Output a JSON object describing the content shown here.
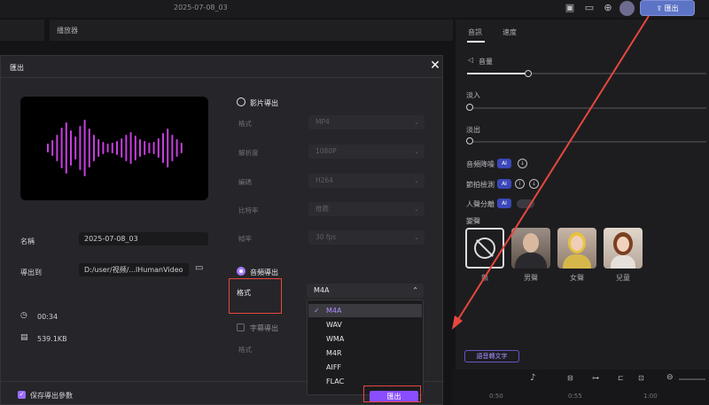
{
  "topbar": {
    "project_title": "2025-07-08_03",
    "export_label": "匯出",
    "icons": [
      "layout-icon",
      "message-icon",
      "download-icon",
      "avatar",
      "export-icon"
    ]
  },
  "editor": {
    "player_tab_label": "播放器",
    "right_tabs": [
      "音訊",
      "速度"
    ],
    "volume_label": "音量",
    "fade_in_label": "淡入",
    "fade_out_label": "淡出",
    "denoise_label": "音頻降噪",
    "beat_label": "節拍檢測",
    "voice_sep_label": "人聲分離",
    "voice_change_label": "變聲",
    "ai_badge": "AI",
    "voices": [
      "無",
      "男聲",
      "女聲",
      "兒童"
    ],
    "speech_to_text_label": "語音轉文字",
    "timeline_ticks": [
      "0:50",
      "0:55",
      "1:00"
    ]
  },
  "modal": {
    "title": "匯出",
    "name_label": "名稱",
    "name_value": "2025-07-08_03",
    "export_to_label": "導出到",
    "export_path": "D:/user/视频/...lHumanVideo",
    "duration": "00:34",
    "file_size": "539.1KB",
    "video_section": {
      "title": "影片導出",
      "fields": [
        {
          "label": "格式",
          "value": "MP4"
        },
        {
          "label": "解析度",
          "value": "1080P"
        },
        {
          "label": "編碼",
          "value": "H264"
        },
        {
          "label": "比特率",
          "value": "推薦"
        },
        {
          "label": "幀率",
          "value": "30  fps"
        }
      ]
    },
    "audio_section": {
      "title": "音頻導出",
      "format_label": "格式",
      "format_value": "M4A",
      "format_options": [
        "M4A",
        "WAV",
        "WMA",
        "M4R",
        "AIFF",
        "FLAC"
      ],
      "selected_index": 0
    },
    "subtitle_export_label": "字幕導出",
    "subtitle_format_label": "格式",
    "save_params_label": "保存導出參數",
    "export_button": "匯出"
  },
  "colors": {
    "accent": "#8a4dff",
    "highlight_box": "#e8473f",
    "waveform": "#c83fe0"
  }
}
